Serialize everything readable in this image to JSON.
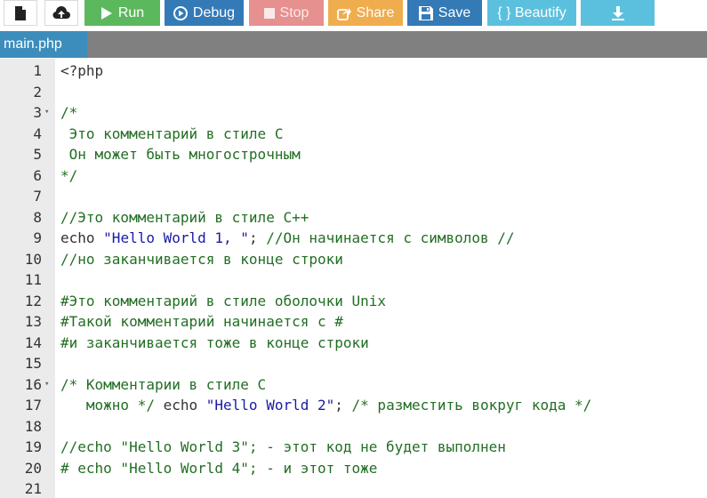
{
  "toolbar": {
    "buttons": [
      {
        "id": "new",
        "label": "",
        "icon": "new-file-icon"
      },
      {
        "id": "upload",
        "label": "",
        "icon": "cloud-upload-icon"
      },
      {
        "id": "run",
        "label": "Run",
        "icon": "play-icon"
      },
      {
        "id": "debug",
        "label": "Debug",
        "icon": "debug-circle-play-icon"
      },
      {
        "id": "stop",
        "label": "Stop",
        "icon": "stop-square-icon"
      },
      {
        "id": "share",
        "label": "Share",
        "icon": "share-icon"
      },
      {
        "id": "save",
        "label": "Save",
        "icon": "floppy-disk-icon"
      },
      {
        "id": "beautify",
        "label": "{ } Beautify",
        "icon": ""
      },
      {
        "id": "download",
        "label": "",
        "icon": "download-icon"
      }
    ],
    "colors": {
      "run": "#5cb85c",
      "debug": "#337ab7",
      "stop": "#e6908f",
      "share": "#f0ad4e",
      "save": "#337ab7",
      "beautify": "#5bc0de",
      "download": "#5bc0de"
    }
  },
  "tabs": [
    {
      "label": "main.php",
      "active": true
    }
  ],
  "editor": {
    "lines": [
      {
        "n": "1",
        "fold": false,
        "parts": [
          {
            "t": "<?php",
            "k": "tag"
          }
        ]
      },
      {
        "n": "2",
        "fold": false,
        "parts": []
      },
      {
        "n": "3",
        "fold": true,
        "parts": [
          {
            "t": "/*",
            "k": "comment"
          }
        ]
      },
      {
        "n": "4",
        "fold": false,
        "parts": [
          {
            "t": " Это комментарий в стиле С",
            "k": "comment"
          }
        ]
      },
      {
        "n": "5",
        "fold": false,
        "parts": [
          {
            "t": " Он может быть многострочным",
            "k": "comment"
          }
        ]
      },
      {
        "n": "6",
        "fold": false,
        "parts": [
          {
            "t": "*/",
            "k": "comment"
          }
        ]
      },
      {
        "n": "7",
        "fold": false,
        "parts": []
      },
      {
        "n": "8",
        "fold": false,
        "parts": [
          {
            "t": "//Это комментарий в стиле С++",
            "k": "comment"
          }
        ]
      },
      {
        "n": "9",
        "fold": false,
        "parts": [
          {
            "t": "echo ",
            "k": "keyword"
          },
          {
            "t": "\"Hello World 1, \"",
            "k": "string"
          },
          {
            "t": "; ",
            "k": "plain"
          },
          {
            "t": "//Он начинается с символов //",
            "k": "comment"
          }
        ]
      },
      {
        "n": "10",
        "fold": false,
        "parts": [
          {
            "t": "//но заканчивается в конце строки",
            "k": "comment"
          }
        ]
      },
      {
        "n": "11",
        "fold": false,
        "parts": []
      },
      {
        "n": "12",
        "fold": false,
        "parts": [
          {
            "t": "#Это комментарий в стиле оболочки Unix",
            "k": "comment"
          }
        ]
      },
      {
        "n": "13",
        "fold": false,
        "parts": [
          {
            "t": "#Такой комментарий начинается с #",
            "k": "comment"
          }
        ]
      },
      {
        "n": "14",
        "fold": false,
        "parts": [
          {
            "t": "#и заканчивается тоже в конце строки",
            "k": "comment"
          }
        ]
      },
      {
        "n": "15",
        "fold": false,
        "parts": []
      },
      {
        "n": "16",
        "fold": true,
        "parts": [
          {
            "t": "/* Комментарии в стиле С",
            "k": "comment"
          }
        ]
      },
      {
        "n": "17",
        "fold": false,
        "parts": [
          {
            "t": "   можно */ ",
            "k": "comment"
          },
          {
            "t": "echo ",
            "k": "keyword"
          },
          {
            "t": "\"Hello World 2\"",
            "k": "string"
          },
          {
            "t": "; ",
            "k": "plain"
          },
          {
            "t": "/* разместить вокруг кода */",
            "k": "comment"
          }
        ]
      },
      {
        "n": "18",
        "fold": false,
        "parts": []
      },
      {
        "n": "19",
        "fold": false,
        "parts": [
          {
            "t": "//echo \"Hello World 3\"; - этот код не будет выполнен",
            "k": "comment"
          }
        ]
      },
      {
        "n": "20",
        "fold": false,
        "parts": [
          {
            "t": "# echo \"Hello World 4\"; - и этот тоже",
            "k": "comment"
          }
        ]
      },
      {
        "n": "21",
        "fold": false,
        "parts": []
      }
    ]
  }
}
